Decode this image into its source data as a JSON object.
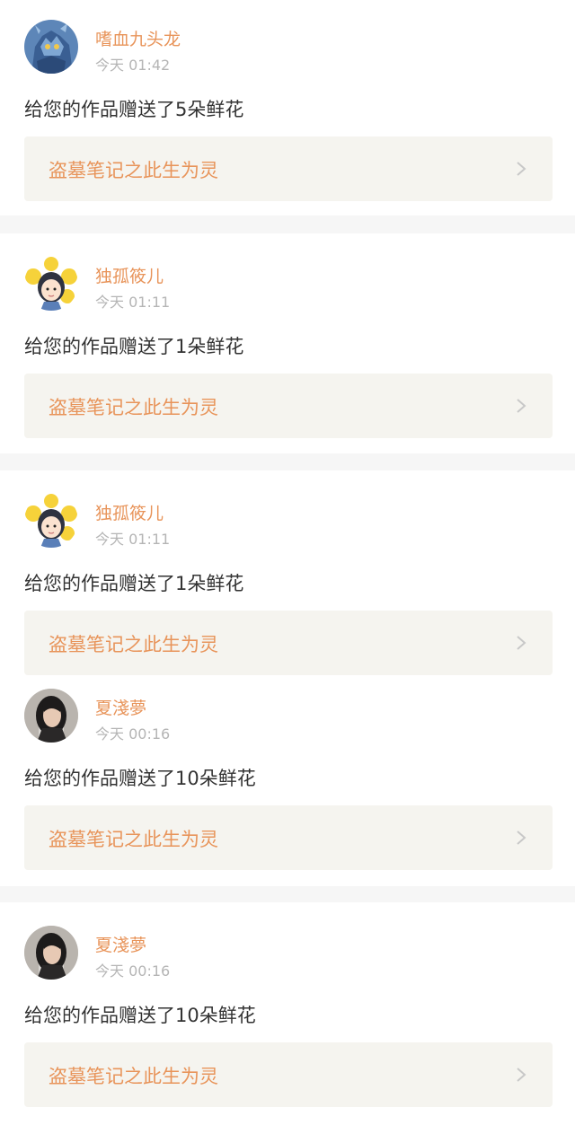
{
  "accent_color": "#e8945a",
  "card_bg": "#f5f4ef",
  "notifications": [
    {
      "avatar": "dragon-avatar",
      "username": "嗜血九头龙",
      "time": "今天 01:42",
      "message": "给您的作品赠送了5朵鲜花",
      "work_title": "盗墓笔记之此生为灵",
      "chevron_icon": "chevron-right-icon"
    },
    {
      "avatar": "cartoon-girl-avatar",
      "username": "独孤筱儿",
      "time": "今天 01:11",
      "message": "给您的作品赠送了1朵鲜花",
      "work_title": "盗墓笔记之此生为灵",
      "chevron_icon": "chevron-right-icon"
    },
    {
      "avatar": "cartoon-girl-avatar",
      "username": "独孤筱儿",
      "time": "今天 01:11",
      "message": "给您的作品赠送了1朵鲜花",
      "work_title": "盗墓笔记之此生为灵",
      "chevron_icon": "chevron-right-icon"
    },
    {
      "avatar": "photo-girl-avatar",
      "username": "夏淺夢",
      "time": "今天 00:16",
      "message": "给您的作品赠送了10朵鲜花",
      "work_title": "盗墓笔记之此生为灵",
      "chevron_icon": "chevron-right-icon"
    },
    {
      "avatar": "photo-girl-avatar",
      "username": "夏淺夢",
      "time": "今天 00:16",
      "message": "给您的作品赠送了10朵鲜花",
      "work_title": "盗墓笔记之此生为灵",
      "chevron_icon": "chevron-right-icon"
    }
  ]
}
